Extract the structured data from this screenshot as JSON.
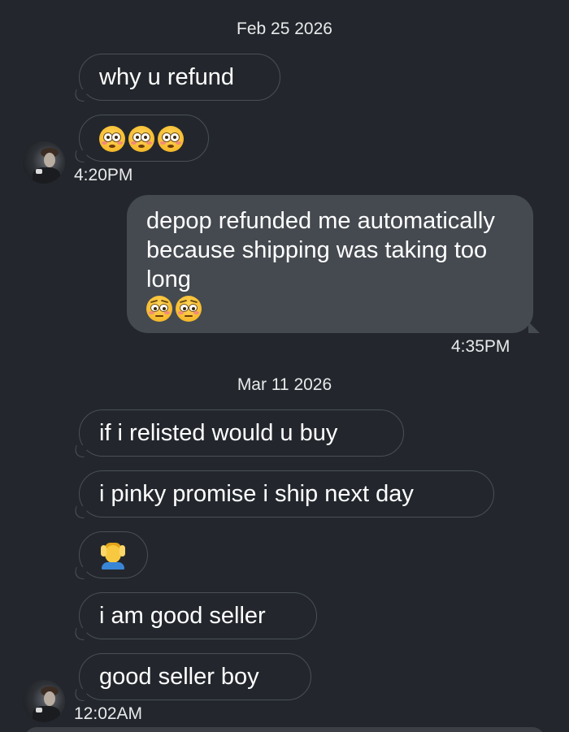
{
  "dates": {
    "first": "Feb 25 2026",
    "second": "Mar 11 2026"
  },
  "messages": {
    "m1": "why u refund",
    "m2_emoji": "flushed-face x3",
    "m3": "depop refunded me automatically because shipping was taking too long",
    "m3_emoji": "pleading-face x2",
    "m4": "if i relisted would u buy",
    "m5": "i pinky promise i ship next day",
    "m6_emoji": "person-getting-massage",
    "m7": "i am good seller",
    "m8": "good seller boy"
  },
  "timestamps": {
    "t1": "4:20PM",
    "t2": "4:35PM",
    "t3": "12:02AM"
  },
  "colors": {
    "background": "#23272d",
    "incoming_border": "#4a4f56",
    "outgoing_bubble": "#454a50",
    "text": "#ffffff"
  }
}
